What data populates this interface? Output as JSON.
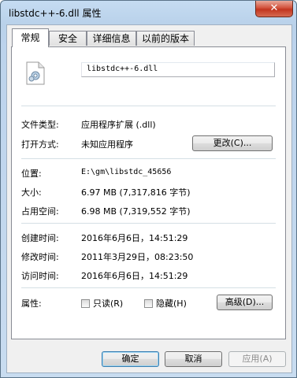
{
  "window": {
    "title": "libstdc++-6.dll 属性",
    "close_label": "✕"
  },
  "tabs": [
    "常规",
    "安全",
    "详细信息",
    "以前的版本"
  ],
  "general": {
    "file_name": "libstdc++-6.dll",
    "rows": {
      "type": {
        "label": "文件类型:",
        "value": "应用程序扩展 (.dll)"
      },
      "opens_with": {
        "label": "打开方式:",
        "value": "未知应用程序",
        "button": "更改(C)..."
      },
      "location": {
        "label": "位置:",
        "value": "E:\\gm\\libstdc_45656"
      },
      "size": {
        "label": "大小:",
        "value": "6.97 MB (7,317,816 字节)"
      },
      "size_on_disk": {
        "label": "占用空间:",
        "value": "6.98 MB (7,319,552 字节)"
      },
      "created": {
        "label": "创建时间:",
        "value": "2016年6月6日，14:51:29"
      },
      "modified": {
        "label": "修改时间:",
        "value": "2011年3月29日，08:23:50"
      },
      "accessed": {
        "label": "访问时间:",
        "value": "2016年6月6日，14:51:29"
      },
      "attributes": {
        "label": "属性:",
        "readonly": "只读(R)",
        "hidden": "隐藏(H)",
        "advanced": "高级(D)..."
      }
    }
  },
  "buttons": {
    "ok": "确定",
    "cancel": "取消",
    "apply": "应用(A)"
  }
}
